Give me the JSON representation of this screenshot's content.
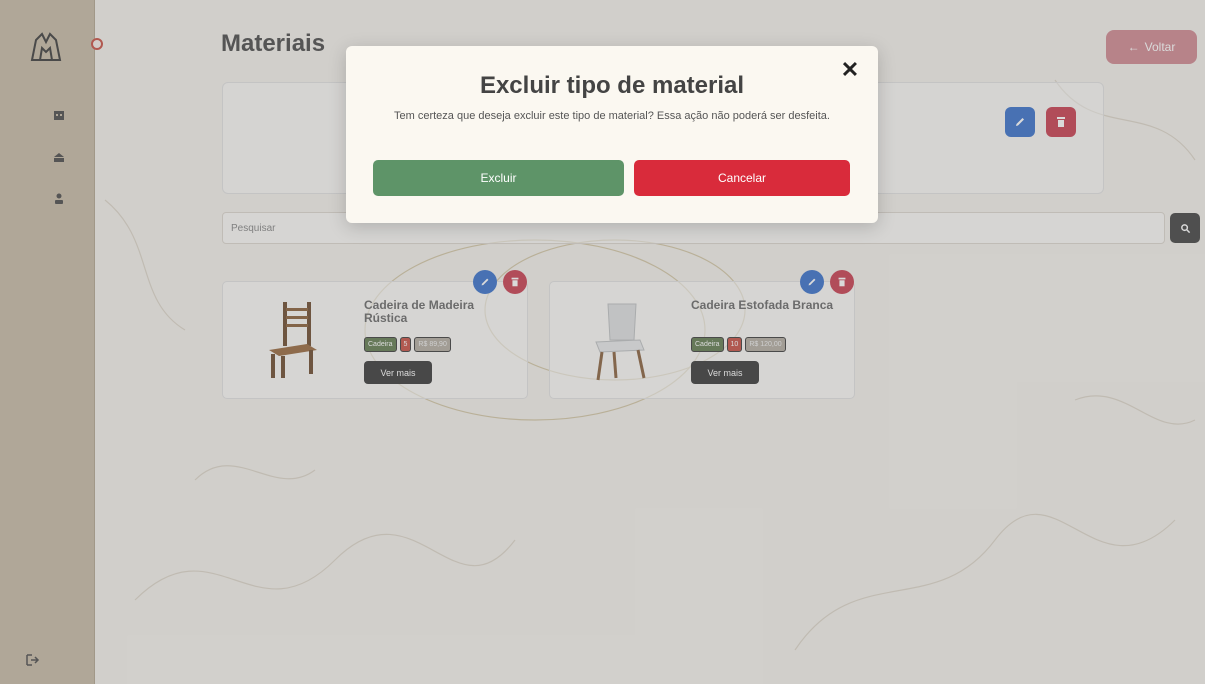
{
  "sidebar": {
    "logo_icon": "shop-logo-icon",
    "items": [
      {
        "icon": "store-icon"
      },
      {
        "icon": "box-icon"
      },
      {
        "icon": "user-icon"
      }
    ],
    "logout_icon": "logout-icon"
  },
  "header": {
    "title": "Materiais",
    "back_label": "Voltar",
    "back_icon": "arrow-left-icon"
  },
  "search": {
    "placeholder": "Pesquisar",
    "button_icon": "search-icon"
  },
  "products": [
    {
      "name": "Cadeira de Madeira Rústica",
      "category": "Cadeira",
      "quantity": "5",
      "price": "R$ 89,90",
      "more_label": "Ver mais"
    },
    {
      "name": "Cadeira Estofada Branca",
      "category": "Cadeira",
      "quantity": "10",
      "price": "R$ 120,00",
      "more_label": "Ver mais"
    }
  ],
  "modal": {
    "title": "Excluir tipo de material",
    "message": "Tem certeza que deseja excluir este tipo de material? Essa ação não poderá ser desfeita.",
    "confirm_label": "Excluir",
    "cancel_label": "Cancelar",
    "close_symbol": "✕"
  },
  "colors": {
    "sidebar": "#bfb19a",
    "confirm": "#5e9468",
    "cancel": "#d92b3b",
    "edit": "#1f5fc4",
    "delete": "#c0263a"
  }
}
